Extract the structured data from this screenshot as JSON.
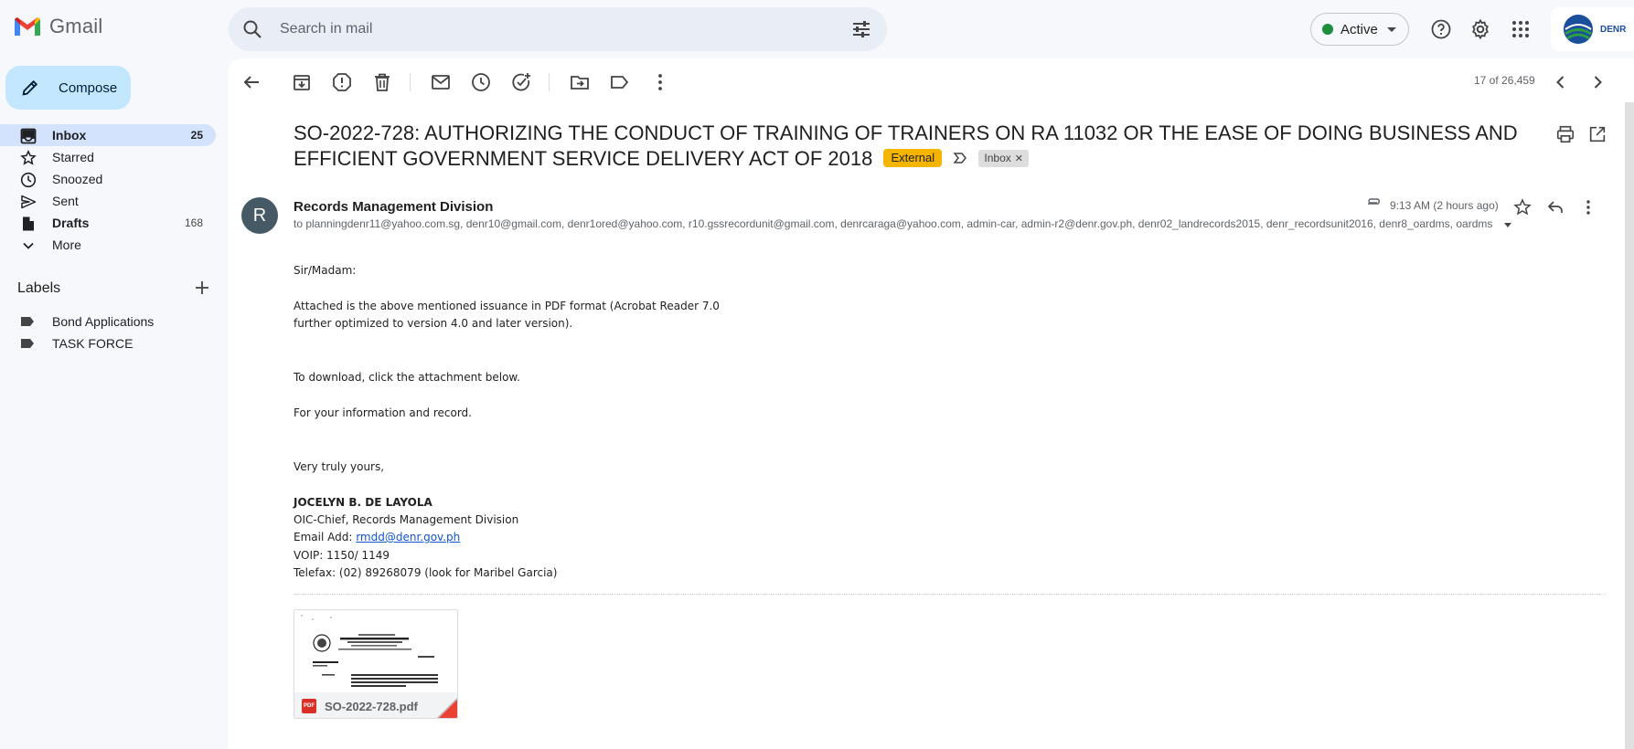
{
  "app": {
    "name": "Gmail"
  },
  "search": {
    "placeholder": "Search in mail"
  },
  "status": {
    "label": "Active"
  },
  "account": {
    "org_badge": "DENR"
  },
  "compose": {
    "label": "Compose"
  },
  "nav": [
    {
      "label": "Inbox",
      "count": "25",
      "icon": "inbox-icon"
    },
    {
      "label": "Starred",
      "count": "",
      "icon": "star-icon"
    },
    {
      "label": "Snoozed",
      "count": "",
      "icon": "clock-icon"
    },
    {
      "label": "Sent",
      "count": "",
      "icon": "send-icon"
    },
    {
      "label": "Drafts",
      "count": "168",
      "icon": "draft-icon"
    },
    {
      "label": "More",
      "count": "",
      "icon": "chevron-down-icon"
    }
  ],
  "labels": {
    "heading": "Labels",
    "items": [
      "Bond Applications",
      "TASK FORCE"
    ]
  },
  "toolbar": {
    "pager": "17 of 26,459"
  },
  "email": {
    "subject": "SO-2022-728: AUTHORIZING THE CONDUCT OF TRAINING OF TRAINERS ON RA 11032 OR THE EASE OF DOING BUSINESS AND EFFICIENT GOVERNMENT SERVICE DELIVERY ACT OF 2018",
    "external_chip": "External",
    "inbox_chip": "Inbox",
    "sender_initial": "R",
    "sender": "Records Management Division",
    "recipients": "to planningdenr11@yahoo.com.sg, denr10@gmail.com, denr1ored@yahoo.com, r10.gssrecordunit@gmail.com, denrcaraga@yahoo.com, admin-car, admin-r2@denr.gov.ph, denr02_landrecords2015, denr_recordsunit2016, denr8_oardms, oardms",
    "timestamp": "9:13 AM (2 hours ago)",
    "body": {
      "greeting": "Sir/Madam:",
      "line1": "Attached is the above mentioned issuance in PDF format (Acrobat Reader 7.0",
      "line2": "further optimized to version 4.0 and later version).",
      "line3": "To download, click the attachment below.",
      "line4": "For your information and record.",
      "closing": "Very truly yours,",
      "sig_name": "JOCELYN B. DE LAYOLA",
      "sig_title": "OIC-Chief, Records Management Division",
      "email_label": "Email Add: ",
      "email_link": "rmdd@denr.gov.ph",
      "voip": "VOIP: 1150/ 1149",
      "telefax": "Telefax: (02) 89268079 (look for Maribel Garcia)"
    },
    "attachment": {
      "name": "SO-2022-728.pdf",
      "type_badge": "PDF"
    }
  },
  "colors": {
    "accent": "#0b57d0",
    "compose_bg": "#c2e7ff",
    "active_nav": "#d3e3fd",
    "external_chip": "#f4b400"
  }
}
